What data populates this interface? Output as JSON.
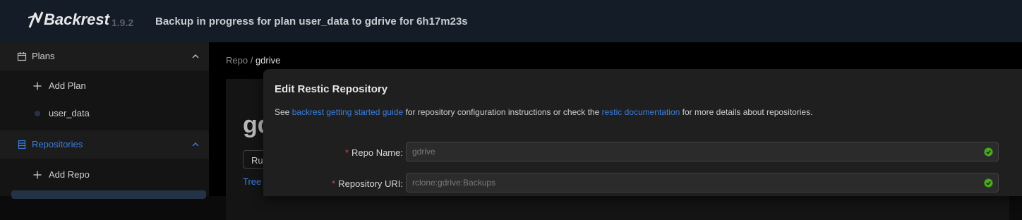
{
  "header": {
    "app_name": "Backrest",
    "version": "1.9.2",
    "status_title": "Backup in progress for plan user_data to gdrive for 6h17m23s"
  },
  "sidebar": {
    "plans_group": {
      "label": "Plans"
    },
    "plan_items": [
      {
        "label": "Add Plan"
      },
      {
        "label": "user_data"
      }
    ],
    "repos_group": {
      "label": "Repositories"
    },
    "repo_items": [
      {
        "label": "Add Repo"
      }
    ]
  },
  "content": {
    "breadcrumb": {
      "root": "Repo",
      "separator": "/",
      "current": "gdrive"
    },
    "repo_title": "gdrive",
    "run_button_label": "Run Command",
    "tab_label": "Tree View"
  },
  "modal": {
    "title": "Edit Restic Repository",
    "desc_before": "See ",
    "desc_link1": "backrest getting started guide",
    "desc_middle": " for repository configuration instructions or check the ",
    "desc_link2": "restic documentation",
    "desc_after": " for more details about repositories.",
    "fields": [
      {
        "label": "Repo Name",
        "value": "gdrive"
      },
      {
        "label": "Repository URI",
        "value": "rclone:gdrive:Backups"
      }
    ]
  },
  "colors": {
    "accent": "#3b7fe0",
    "success": "#49aa19",
    "required": "#e0413f"
  }
}
